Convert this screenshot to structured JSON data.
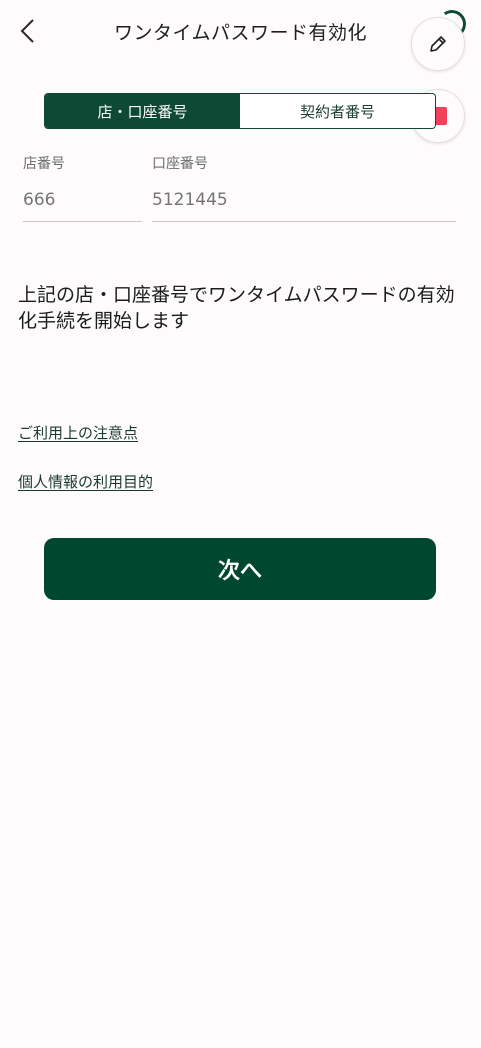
{
  "header": {
    "title": "ワンタイムパスワード有効化",
    "back_icon": "chevron-left-icon"
  },
  "floating": {
    "edit_icon": "pencil-icon",
    "stop_icon": "stop-icon",
    "stop_color": "#f0405a"
  },
  "tabs": [
    {
      "label": "店・口座番号",
      "active": true
    },
    {
      "label": "契約者番号",
      "active": false
    }
  ],
  "fields": {
    "branch": {
      "label": "店番号",
      "placeholder": "666"
    },
    "account": {
      "label": "口座番号",
      "placeholder": "5121445"
    }
  },
  "message": "上記の店・口座番号でワンタイムパスワードの有効化手続を開始します",
  "links": {
    "notes": "ご利用上の注意点",
    "privacy": "個人情報の利用目的"
  },
  "next_button": "次へ",
  "colors": {
    "primary": "#00472f",
    "background": "#fdfbfc"
  }
}
